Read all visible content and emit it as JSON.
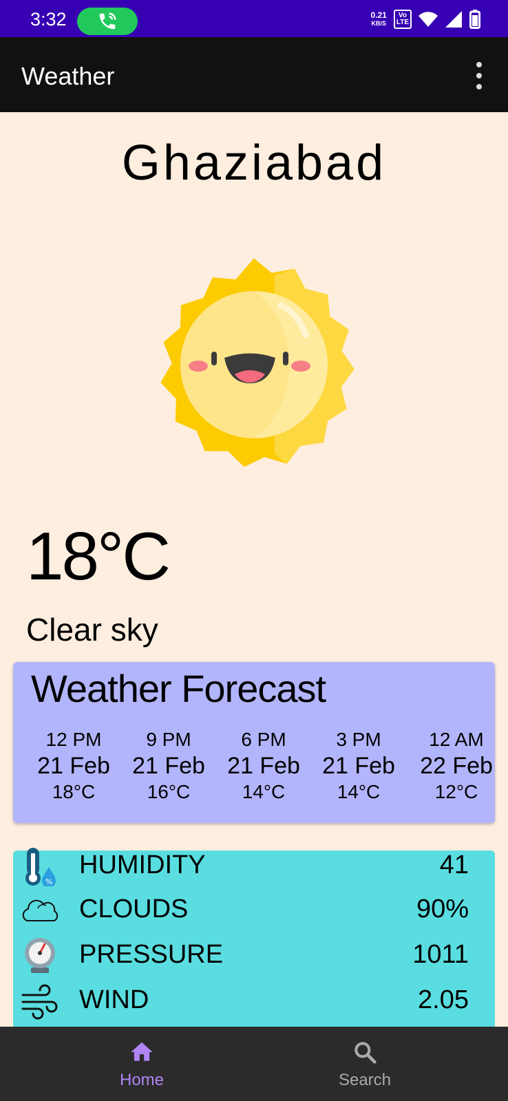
{
  "status_bar": {
    "time": "3:32",
    "net_speed_value": "0.21",
    "net_speed_unit": "KB/S",
    "volte_top": "Vo",
    "volte_bottom": "LTE",
    "call_icon": "phone-call-icon",
    "call_pill_color": "#21C95D"
  },
  "app_bar": {
    "title": "Weather",
    "menu_icon": "more-vertical-icon"
  },
  "weather": {
    "city": "Ghaziabad",
    "icon": "smiling-sun-icon",
    "temperature": "18°C",
    "condition": "Clear sky"
  },
  "forecast": {
    "title": "Weather Forecast",
    "items": [
      {
        "time": "12 PM",
        "date": "21 Feb",
        "temp": "18°C"
      },
      {
        "time": "9 PM",
        "date": "21 Feb",
        "temp": "16°C"
      },
      {
        "time": "6 PM",
        "date": "21 Feb",
        "temp": "14°C"
      },
      {
        "time": "3 PM",
        "date": "21 Feb",
        "temp": "14°C"
      },
      {
        "time": "12 AM",
        "date": "22 Feb",
        "temp": "12°C"
      }
    ]
  },
  "stats": [
    {
      "icon": "humidity-thermometer-icon",
      "label": "HUMIDITY",
      "value": "41"
    },
    {
      "icon": "cloud-icon",
      "label": "CLOUDS",
      "value": "90%"
    },
    {
      "icon": "pressure-gauge-icon",
      "label": "PRESSURE",
      "value": "1011"
    },
    {
      "icon": "wind-icon",
      "label": "WIND",
      "value": "2.05"
    }
  ],
  "bottom_nav": {
    "items": [
      {
        "label": "Home",
        "icon": "home-icon",
        "active": true
      },
      {
        "label": "Search",
        "icon": "search-icon",
        "active": false
      }
    ]
  },
  "colors": {
    "status_bar": "#3700B3",
    "app_bar": "#111111",
    "page_background": "#FDEEDF",
    "forecast_card": "#B3B5FC",
    "stats_card": "#59DDE0",
    "bottom_nav": "#2B2B2B",
    "nav_active": "#B085F5",
    "nav_inactive": "#AAAAAA"
  }
}
